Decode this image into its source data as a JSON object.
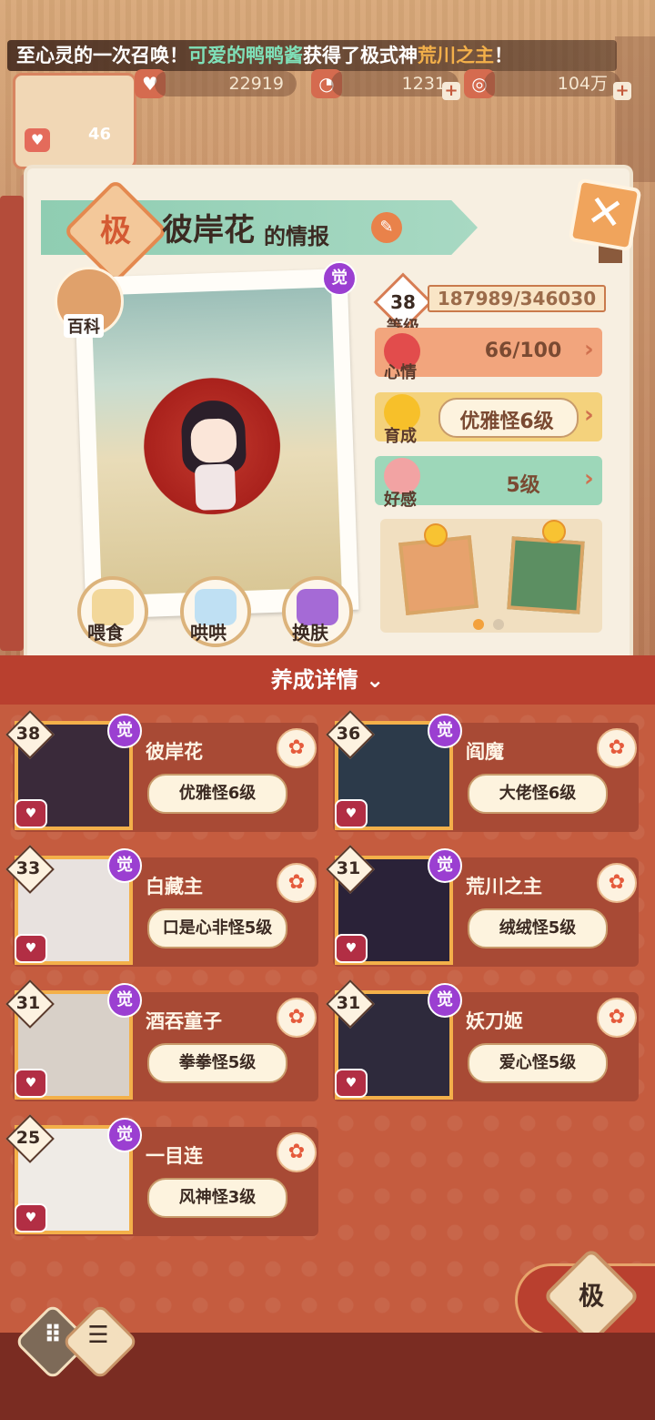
{
  "marquee": {
    "pre": "至心灵的一次召唤！",
    "user": "可爱的鸭鸭酱",
    "mid": "获得了极式神",
    "target": "荒川之主",
    "end": "！"
  },
  "resources": {
    "coins": "22919",
    "jade": "1231",
    "money": "104万"
  },
  "profile": {
    "level": "46"
  },
  "info": {
    "badge": "极",
    "name": "彼岸花",
    "title_suffix": "的情报",
    "awaken": "觉",
    "wiki_label": "百科",
    "level": "38",
    "level_label": "等级",
    "exp": "187989/346030",
    "mood_label": "心情",
    "mood_value": "66/100",
    "grow_label": "育成",
    "grow_value": "优雅怪6级",
    "fav_label": "好感",
    "fav_value": "5级",
    "actions": [
      "喂食",
      "哄哄",
      "换肤"
    ]
  },
  "detail_title": "养成详情",
  "cards": [
    {
      "level": "38",
      "name": "彼岸花",
      "stage": "优雅怪6级",
      "awaken": "觉"
    },
    {
      "level": "36",
      "name": "阎魔",
      "stage": "大佬怪6级",
      "awaken": "觉"
    },
    {
      "level": "33",
      "name": "白藏主",
      "stage": "口是心非怪5级",
      "awaken": "觉"
    },
    {
      "level": "31",
      "name": "荒川之主",
      "stage": "绒绒怪5级",
      "awaken": "觉"
    },
    {
      "level": "31",
      "name": "酒吞童子",
      "stage": "拳拳怪5级",
      "awaken": "觉"
    },
    {
      "level": "31",
      "name": "妖刀姬",
      "stage": "爱心怪5级",
      "awaken": "觉"
    },
    {
      "level": "25",
      "name": "一目连",
      "stage": "风神怪3级",
      "awaken": "觉"
    }
  ],
  "fab_label": "极",
  "colors": {
    "accent": "#c45a3d",
    "awaken": "#9b3fd1",
    "gold_frame": "#f3b04a"
  }
}
